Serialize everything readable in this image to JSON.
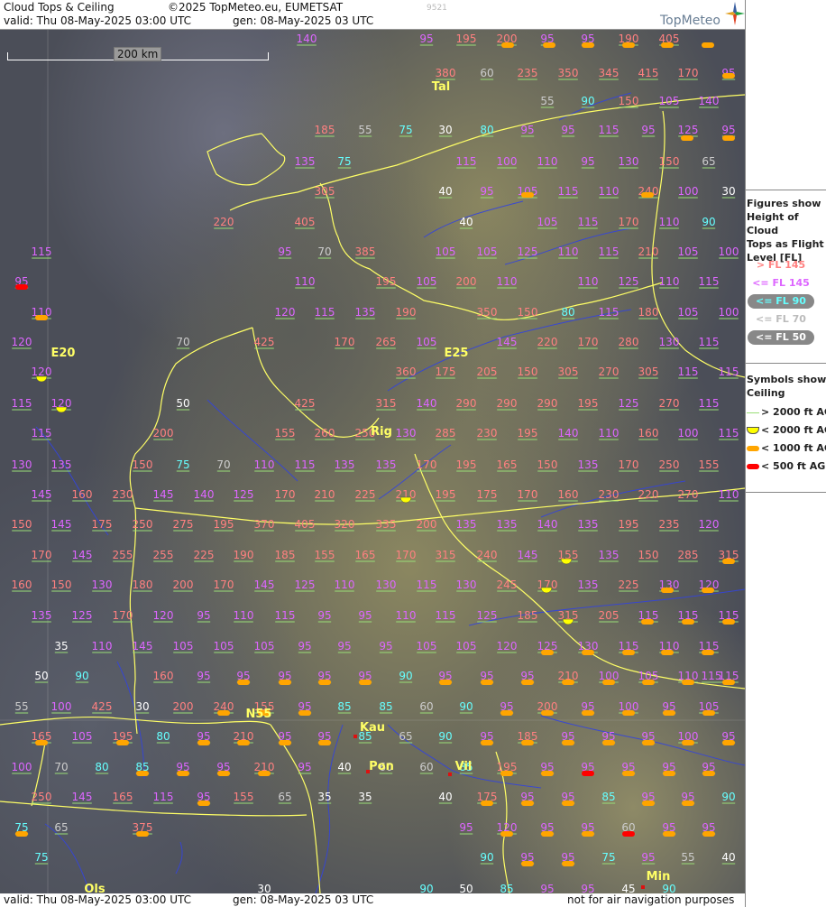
{
  "header": {
    "title": "Cloud Tops & Ceiling",
    "copyright": "©2025 TopMeteo.eu, EUMETSAT",
    "code": "9521",
    "valid": "valid:  Thu  08-May-2025  03:00 UTC",
    "gen": "gen: 08-May-2025 03 UTC",
    "logo": "TopMeteo"
  },
  "footer": {
    "valid": "valid:  Thu  08-May-2025  03:00 UTC",
    "gen": "gen: 08-May-2025 03 UTC",
    "note": "not for air navigation purposes"
  },
  "scale_bar": {
    "label": "200 km"
  },
  "legend": {
    "tops_title": [
      "Figures show",
      "Height of Cloud",
      "Tops as Flight",
      "Level  [FL]"
    ],
    "tops": [
      {
        "text": "> FL 145",
        "color": "#ff8080",
        "pill": false
      },
      {
        "text": "<= FL 145",
        "color": "#dd66ff",
        "pill": false
      },
      {
        "text": "<= FL 90",
        "color": "#66ffff",
        "pill": true
      },
      {
        "text": "<= FL 70",
        "color": "#bbbbbb",
        "pill": false
      },
      {
        "text": "<= FL 50",
        "color": "#ffffff",
        "pill": true
      }
    ],
    "ceiling_title": [
      "Symbols show",
      "Ceiling"
    ],
    "ceiling": [
      {
        "text": "> 2000 ft AGL",
        "symbol": "line",
        "color": "#99dd77"
      },
      {
        "text": "< 2000 ft AGL",
        "symbol": "half",
        "color": "#ffff00"
      },
      {
        "text": "< 1000 ft AGL",
        "symbol": "pill",
        "color": "#ffa500"
      },
      {
        "text": "< 500 ft AGL",
        "symbol": "pill",
        "color": "#ff0000"
      }
    ]
  },
  "colors": {
    "fl_gt145": "#ff8080",
    "fl_le145": "#dd66ff",
    "fl_le90": "#66ffff",
    "fl_le70": "#cccccc",
    "fl_le50": "#ffffff",
    "city": "#ffff66",
    "border": "#ffff66",
    "river": "#3344dd"
  },
  "places": [
    "Tal",
    "Rig",
    "Kau",
    "Pon",
    "Vil",
    "Min",
    "Ols",
    "E20",
    "E25",
    "N55"
  ],
  "map_labels": [
    [
      "140",
      "95",
      "195",
      "200",
      "95",
      "95",
      "190",
      "405"
    ],
    [
      "380",
      "60",
      "235",
      "350",
      "345",
      "415",
      "170",
      "95"
    ],
    [
      "55",
      "90",
      "150",
      "105",
      "140"
    ],
    [
      "185",
      "55",
      "75",
      "30",
      "80",
      "95",
      "95",
      "115",
      "95",
      "125",
      "95"
    ],
    [
      "135",
      "75",
      "115",
      "100",
      "110",
      "95",
      "130",
      "150",
      "65"
    ],
    [
      "305",
      "40",
      "95",
      "105",
      "115",
      "110",
      "240",
      "100",
      "30"
    ],
    [
      "220",
      "405",
      "40",
      "105",
      "115",
      "170",
      "110",
      "90"
    ],
    [
      "115",
      "95",
      "70",
      "385",
      "105",
      "105",
      "125",
      "110",
      "115",
      "210",
      "105",
      "100"
    ],
    [
      "95",
      "110",
      "195",
      "105",
      "200",
      "110",
      "110",
      "125",
      "110",
      "115"
    ],
    [
      "110",
      "120",
      "115",
      "135",
      "190",
      "350",
      "150",
      "80",
      "115",
      "180",
      "105",
      "100"
    ],
    [
      "120",
      "70",
      "425",
      "170",
      "265",
      "105",
      "145",
      "220",
      "170",
      "280",
      "130",
      "115"
    ],
    [
      "120",
      "360",
      "175",
      "205",
      "150",
      "305",
      "270",
      "305",
      "115",
      "115"
    ],
    [
      "115",
      "120",
      "50",
      "425",
      "315",
      "140",
      "290",
      "290",
      "290",
      "195",
      "125",
      "270",
      "115"
    ],
    [
      "115",
      "200",
      "155",
      "260",
      "250",
      "130",
      "285",
      "230",
      "195",
      "140",
      "110",
      "160",
      "100",
      "115"
    ],
    [
      "130",
      "135",
      "150",
      "75",
      "70",
      "110",
      "115",
      "135",
      "135",
      "170",
      "195",
      "165",
      "150",
      "135",
      "170",
      "250",
      "155"
    ],
    [
      "145",
      "160",
      "230",
      "145",
      "140",
      "125",
      "170",
      "210",
      "225",
      "210",
      "195",
      "175",
      "170",
      "160",
      "230",
      "220",
      "270",
      "110"
    ],
    [
      "150",
      "145",
      "175",
      "250",
      "275",
      "195",
      "370",
      "405",
      "320",
      "335",
      "200",
      "135",
      "135",
      "140",
      "135",
      "195",
      "235",
      "120"
    ],
    [
      "170",
      "145",
      "255",
      "255",
      "225",
      "190",
      "185",
      "155",
      "165",
      "170",
      "315",
      "240",
      "145",
      "155",
      "135",
      "150",
      "285",
      "315"
    ],
    [
      "160",
      "150",
      "130",
      "180",
      "200",
      "170",
      "145",
      "125",
      "110",
      "130",
      "115",
      "130",
      "245",
      "170",
      "135",
      "225",
      "130",
      "120"
    ],
    [
      "135",
      "125",
      "170",
      "120",
      "95",
      "110",
      "115",
      "95",
      "95",
      "110",
      "115",
      "125",
      "185",
      "315",
      "205",
      "115",
      "115",
      "115"
    ],
    [
      "35",
      "110",
      "145",
      "105",
      "105",
      "105",
      "95",
      "95",
      "95",
      "105",
      "105",
      "120",
      "125",
      "130",
      "115",
      "110",
      "115"
    ],
    [
      "50",
      "90",
      "160",
      "95",
      "95",
      "95",
      "95",
      "95",
      "90",
      "95",
      "95",
      "95",
      "210",
      "100",
      "105",
      "110",
      "115",
      "115"
    ],
    [
      "55",
      "100",
      "425",
      "30",
      "200",
      "240",
      "155",
      "95",
      "85",
      "85",
      "60",
      "90",
      "95",
      "200",
      "95",
      "100",
      "95",
      "105"
    ],
    [
      "165",
      "105",
      "195",
      "80",
      "95",
      "210",
      "95",
      "95",
      "85",
      "65",
      "90",
      "95",
      "185",
      "95",
      "95",
      "95",
      "100",
      "95"
    ],
    [
      "100",
      "70",
      "80",
      "85",
      "95",
      "95",
      "210",
      "95",
      "40",
      "60",
      "60",
      "85",
      "195",
      "95",
      "95",
      "95",
      "95",
      "95"
    ],
    [
      "250",
      "145",
      "165",
      "115",
      "95",
      "155",
      "65",
      "35",
      "35",
      "40",
      "175",
      "95",
      "95",
      "85",
      "95",
      "95",
      "90"
    ],
    [
      "75",
      "65",
      "375",
      "95",
      "120",
      "95",
      "95",
      "60",
      "95",
      "95"
    ],
    [
      "75",
      "90",
      "95",
      "95",
      "75",
      "95",
      "55",
      "40"
    ],
    [
      "30",
      "90",
      "50",
      "85",
      "95",
      "95",
      "45",
      "90"
    ]
  ]
}
